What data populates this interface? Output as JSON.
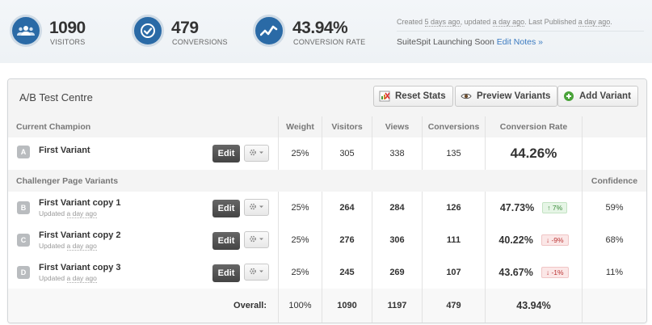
{
  "stats": [
    {
      "icon": "users-icon",
      "value": "1090",
      "label": "VISITORS"
    },
    {
      "icon": "check-circle-icon",
      "value": "479",
      "label": "CONVERSIONS"
    },
    {
      "icon": "trend-line-icon",
      "value": "43.94%",
      "label": "CONVERSION RATE"
    }
  ],
  "meta": {
    "created_prefix": "Created ",
    "created_ago": "5 days ago",
    "updated_prefix": ", updated ",
    "updated_ago": "a day ago",
    "published_prefix": ". Last Published ",
    "published_ago": "a day ago",
    "published_suffix": ".",
    "project_name": "SuiteSpit Launching Soon ",
    "edit_notes": "Edit Notes »"
  },
  "panel": {
    "title": "A/B Test Centre",
    "buttons": {
      "reset": "Reset Stats",
      "preview": "Preview Variants",
      "add": "Add Variant"
    }
  },
  "table": {
    "champion_header": "Current Champion",
    "columns": {
      "weight": "Weight",
      "visitors": "Visitors",
      "views": "Views",
      "conversions": "Conversions",
      "rate": "Conversion Rate"
    },
    "challengers_header": "Challenger Page Variants",
    "confidence_header": "Confidence",
    "edit_label": "Edit",
    "updated_prefix": "Updated ",
    "champion": {
      "letter": "A",
      "name": "First Variant",
      "weight": "25%",
      "visitors": "305",
      "views": "338",
      "conversions": "135",
      "rate": "44.26%"
    },
    "challengers": [
      {
        "letter": "B",
        "name": "First Variant copy 1",
        "updated": "a day ago",
        "weight": "25%",
        "visitors": "264",
        "views": "284",
        "conversions": "126",
        "rate": "47.73%",
        "change": "↑ 7%",
        "direction": "up",
        "confidence": "59%"
      },
      {
        "letter": "C",
        "name": "First Variant copy 2",
        "updated": "a day ago",
        "weight": "25%",
        "visitors": "276",
        "views": "306",
        "conversions": "111",
        "rate": "40.22%",
        "change": "↓ -9%",
        "direction": "down",
        "confidence": "68%"
      },
      {
        "letter": "D",
        "name": "First Variant copy 3",
        "updated": "a day ago",
        "weight": "25%",
        "visitors": "245",
        "views": "269",
        "conversions": "107",
        "rate": "43.67%",
        "change": "↓ -1%",
        "direction": "down",
        "confidence": "11%"
      }
    ],
    "overall": {
      "label": "Overall:",
      "weight": "100%",
      "visitors": "1090",
      "views": "1197",
      "conversions": "479",
      "rate": "43.94%"
    }
  },
  "colors": {
    "accent": "#2a6aa6",
    "link": "#3a7ac0",
    "up": "#3a8a3a",
    "down": "#bb3333"
  }
}
